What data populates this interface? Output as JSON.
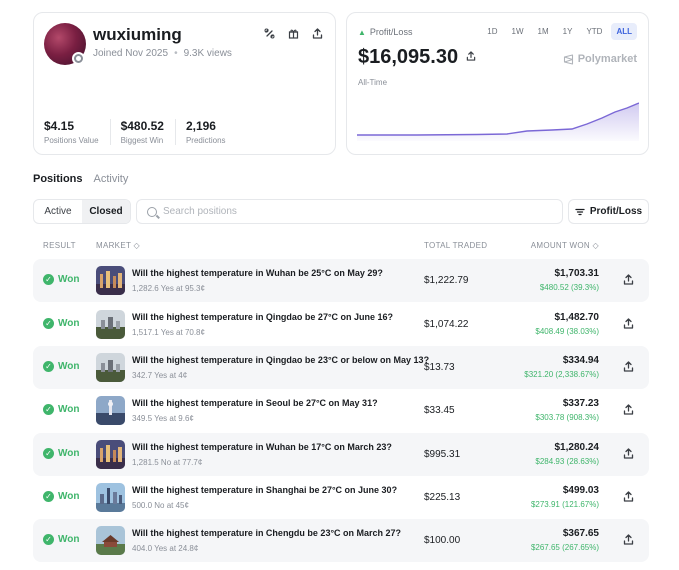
{
  "profile": {
    "username": "wuxiuming",
    "joined": "Joined Nov 2025",
    "views": "9.3K views",
    "stats": [
      {
        "value": "$4.15",
        "label": "Positions Value"
      },
      {
        "value": "$480.52",
        "label": "Biggest Win"
      },
      {
        "value": "2,196",
        "label": "Predictions"
      }
    ]
  },
  "pnl": {
    "label": "Profit/Loss",
    "value": "$16,095.30",
    "period": "All-Time",
    "brand": "Polymarket",
    "ranges": [
      "1D",
      "1W",
      "1M",
      "1Y",
      "YTD",
      "ALL"
    ],
    "active_range": "ALL",
    "accent": "#7b68d6"
  },
  "tabs": [
    "Positions",
    "Activity"
  ],
  "filters": {
    "active": "Active",
    "closed": "Closed"
  },
  "search": {
    "placeholder": "Search positions"
  },
  "sort": {
    "label": "Profit/Loss"
  },
  "table": {
    "headers": {
      "result": "RESULT",
      "market": "MARKET",
      "total": "TOTAL TRADED",
      "amount": "AMOUNT WON"
    },
    "rows": [
      {
        "result": "Won",
        "question": "Will the highest temperature in Wuhan be 25°C on May 29?",
        "sub": "1,282.6 Yes at 95.3¢",
        "total": "$1,222.79",
        "amount": "$1,703.31",
        "gain": "$480.52 (39.3%)",
        "thumb": "city-night"
      },
      {
        "result": "Won",
        "question": "Will the highest temperature in Qingdao be 27°C on June 16?",
        "sub": "1,517.1 Yes at 70.8¢",
        "total": "$1,074.22",
        "amount": "$1,482.70",
        "gain": "$408.49 (38.03%)",
        "thumb": "coast"
      },
      {
        "result": "Won",
        "question": "Will the highest temperature in Qingdao be 23°C or below on May 13?",
        "sub": "342.7 Yes at 4¢",
        "total": "$13.73",
        "amount": "$334.94",
        "gain": "$321.20 (2,338.67%)",
        "thumb": "coast"
      },
      {
        "result": "Won",
        "question": "Will the highest temperature in Seoul be 27°C on May 31?",
        "sub": "349.5 Yes at 9.6¢",
        "total": "$33.45",
        "amount": "$337.23",
        "gain": "$303.78 (908.3%)",
        "thumb": "tower"
      },
      {
        "result": "Won",
        "question": "Will the highest temperature in Wuhan be 17°C on March 23?",
        "sub": "1,281.5 No at 77.7¢",
        "total": "$995.31",
        "amount": "$1,280.24",
        "gain": "$284.93 (28.63%)",
        "thumb": "city-night"
      },
      {
        "result": "Won",
        "question": "Will the highest temperature in Shanghai be 27°C on June 30?",
        "sub": "500.0 No at 45¢",
        "total": "$225.13",
        "amount": "$499.03",
        "gain": "$273.91 (121.67%)",
        "thumb": "skyline"
      },
      {
        "result": "Won",
        "question": "Will the highest temperature in Chengdu be 23°C on March 27?",
        "sub": "404.0 Yes at 24.8¢",
        "total": "$100.00",
        "amount": "$367.65",
        "gain": "$267.65 (267.65%)",
        "thumb": "temple"
      }
    ]
  }
}
